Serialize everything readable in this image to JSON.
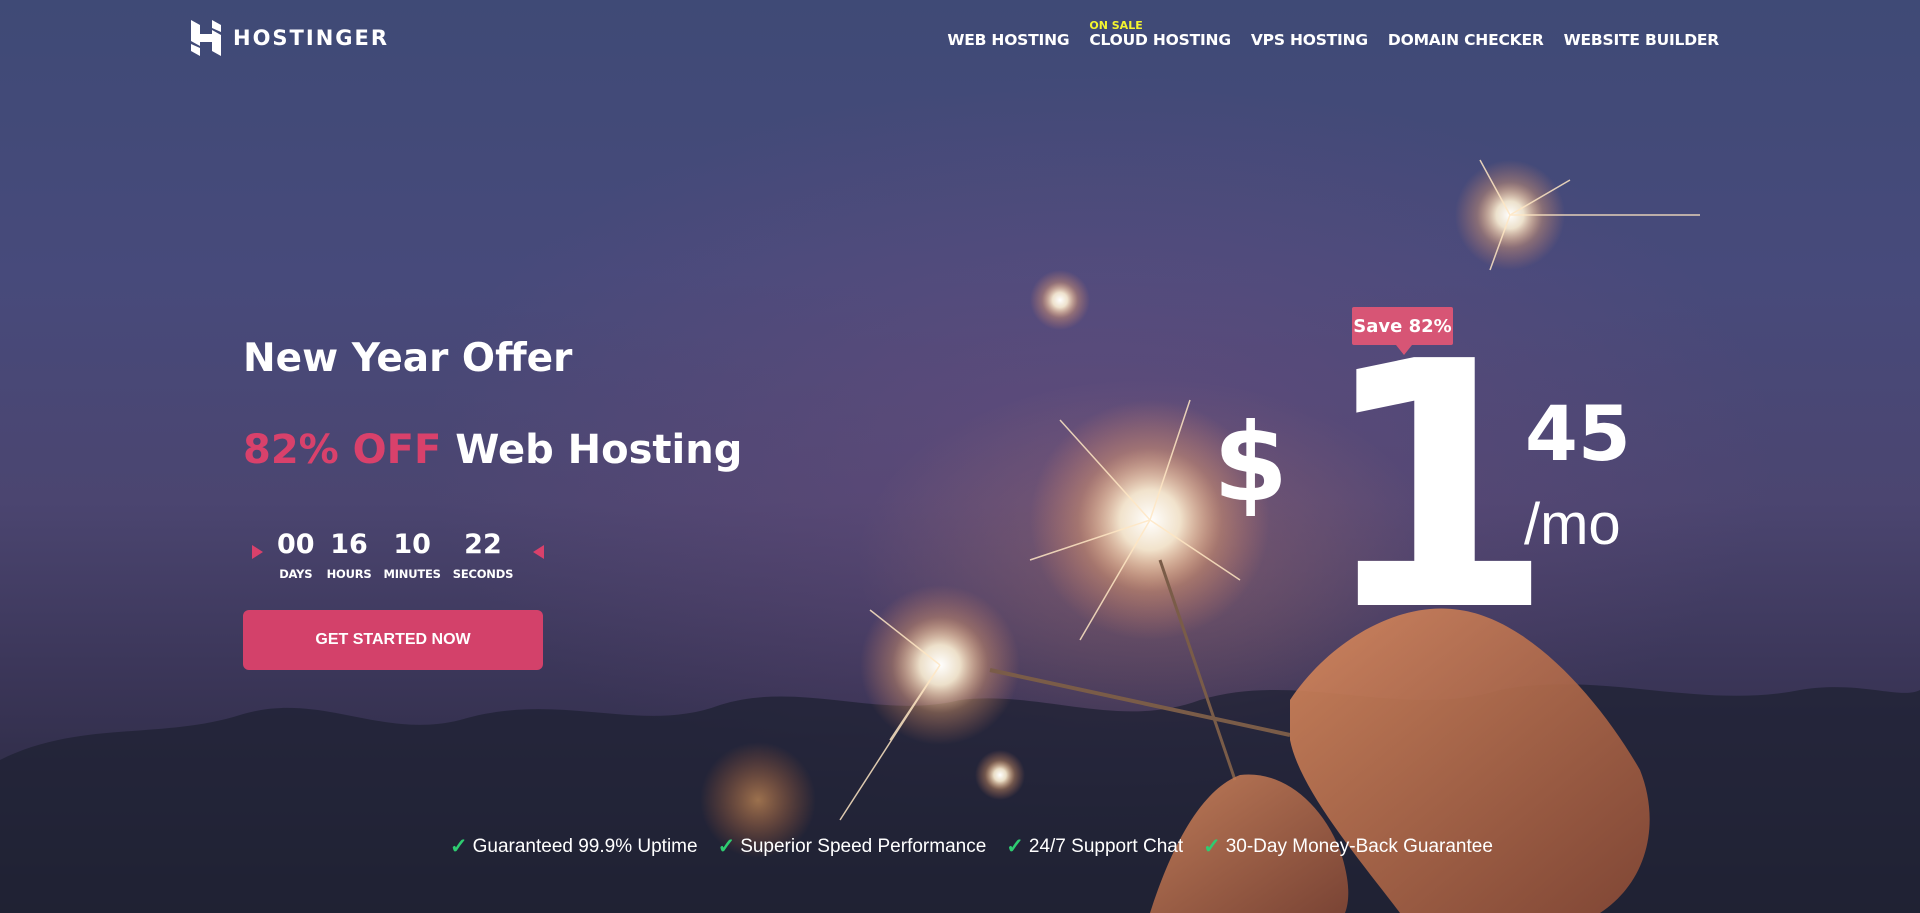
{
  "header": {
    "logo_text": "HOSTINGER",
    "nav": [
      {
        "label": "WEB HOSTING",
        "badge": ""
      },
      {
        "label": "CLOUD HOSTING",
        "badge": "ON SALE"
      },
      {
        "label": "VPS HOSTING",
        "badge": ""
      },
      {
        "label": "DOMAIN CHECKER",
        "badge": ""
      },
      {
        "label": "WEBSITE BUILDER",
        "badge": ""
      }
    ]
  },
  "hero": {
    "title": "New Year Offer",
    "discount": "82% OFF",
    "product": "Web Hosting",
    "countdown": [
      {
        "value": "00",
        "label": "DAYS"
      },
      {
        "value": "16",
        "label": "HOURS"
      },
      {
        "value": "10",
        "label": "MINUTES"
      },
      {
        "value": "22",
        "label": "SECONDS"
      }
    ],
    "cta_label": "GET STARTED NOW"
  },
  "price": {
    "save_badge": "Save 82%",
    "currency": "$",
    "dollars": "1",
    "cents": "45",
    "period": "/mo"
  },
  "features": [
    "Guaranteed 99.9% Uptime",
    "Superior Speed Performance",
    "24/7 Support Chat",
    "30-Day Money-Back Guarantee"
  ],
  "icons": {
    "logo": "hostinger-logo-icon",
    "check": "check-icon",
    "countdown_arrows": "triangle-arrow-icon"
  },
  "colors": {
    "accent": "#d3416a",
    "badge_yellow": "#f4f42e",
    "check_green": "#2ecc71",
    "background_top": "#3f4a76",
    "background_bottom": "#232436"
  }
}
